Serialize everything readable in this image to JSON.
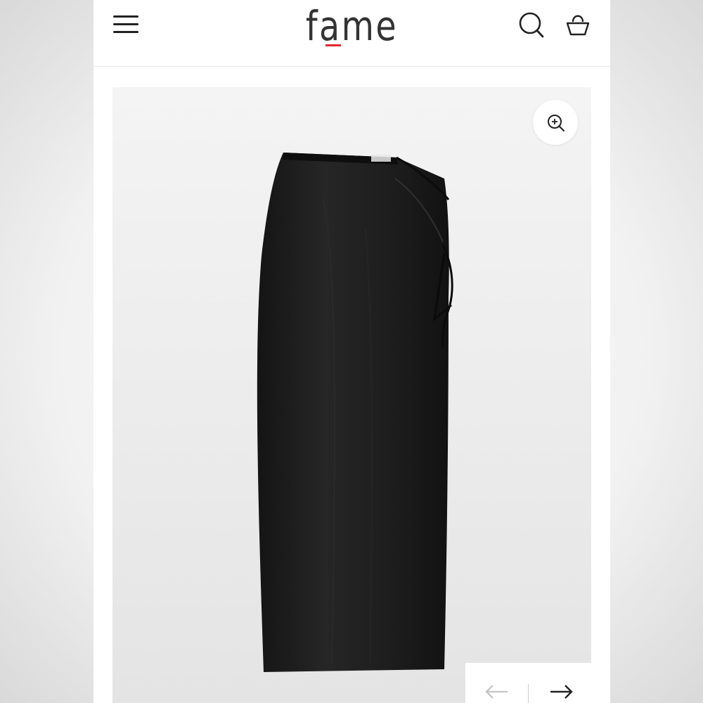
{
  "header": {
    "logo_text": "fame",
    "menu_icon": "hamburger-icon",
    "search_icon": "search-icon",
    "cart_icon": "shopping-basket-icon",
    "accent_color": "#e3262f"
  },
  "product_image": {
    "zoom_icon": "zoom-in-icon",
    "garment_color": "#1c1c1c",
    "background_color": "#ededed"
  },
  "gallery_nav": {
    "prev_icon": "arrow-left-icon",
    "next_icon": "arrow-right-icon",
    "prev_enabled": false,
    "next_enabled": true
  }
}
